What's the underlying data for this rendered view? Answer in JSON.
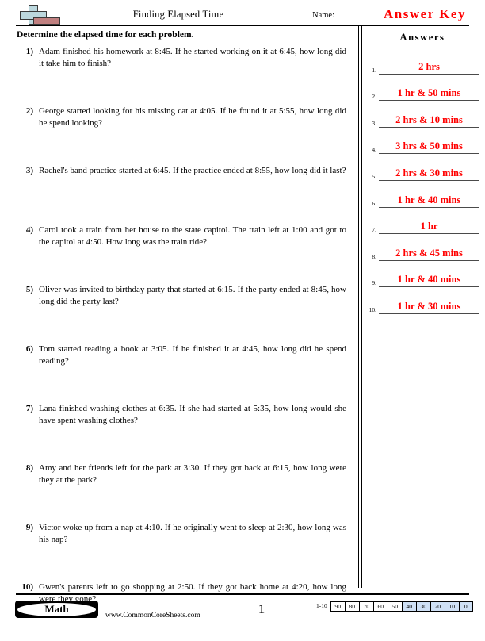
{
  "header": {
    "logo_name": "commoncoresheets-cross-logo",
    "title": "Finding Elapsed Time",
    "name_label": "Name:",
    "answer_key_label": "Answer Key"
  },
  "instructions": "Determine the elapsed time for each problem.",
  "questions": [
    {
      "num": "1)",
      "text": "Adam finished his homework at 8:45. If he started working on it at 6:45, how long did it take him to finish?"
    },
    {
      "num": "2)",
      "text": "George started looking for his missing cat at 4:05. If he found it at 5:55, how long did he spend looking?"
    },
    {
      "num": "3)",
      "text": "Rachel's band practice started at 6:45. If the practice ended at 8:55, how long did it last?"
    },
    {
      "num": "4)",
      "text": "Carol took a train from her house to the state capitol. The train left at 1:00 and got to the capitol at 4:50. How long was the train ride?"
    },
    {
      "num": "5)",
      "text": "Oliver was invited to birthday party that started at 6:15. If the party ended at 8:45, how long did the party last?"
    },
    {
      "num": "6)",
      "text": "Tom started reading a book at 3:05. If he finished it at 4:45, how long did he spend reading?"
    },
    {
      "num": "7)",
      "text": "Lana finished washing clothes at 6:35. If she had started at 5:35, how long would she have spent washing clothes?"
    },
    {
      "num": "8)",
      "text": "Amy and her friends left for the park at 3:30. If they got back at 6:15, how long were they at the park?"
    },
    {
      "num": "9)",
      "text": "Victor woke up from a nap at 4:10. If he originally went to sleep at 2:30, how long was his nap?"
    },
    {
      "num": "10)",
      "text": "Gwen's parents left to go shopping at 2:50. If they got back home at 4:20, how long were they gone?"
    }
  ],
  "answers": {
    "heading": "Answers",
    "items": [
      {
        "idx": "1.",
        "value": "2 hrs"
      },
      {
        "idx": "2.",
        "value": "1 hr & 50 mins"
      },
      {
        "idx": "3.",
        "value": "2 hrs & 10 mins"
      },
      {
        "idx": "4.",
        "value": "3 hrs & 50 mins"
      },
      {
        "idx": "5.",
        "value": "2 hrs & 30 mins"
      },
      {
        "idx": "6.",
        "value": "1 hr & 40 mins"
      },
      {
        "idx": "7.",
        "value": "1 hr"
      },
      {
        "idx": "8.",
        "value": "2 hrs & 45 mins"
      },
      {
        "idx": "9.",
        "value": "1 hr & 40 mins"
      },
      {
        "idx": "10.",
        "value": "1 hr & 30 mins"
      }
    ]
  },
  "footer": {
    "subject_badge": "Math",
    "site_url": "www.CommonCoreSheets.com",
    "page_number": "1",
    "scale_range_label": "1-10",
    "scale_values": [
      "90",
      "80",
      "70",
      "60",
      "50",
      "40",
      "30",
      "20",
      "10",
      "0"
    ],
    "scale_highlight_from_index": 5,
    "highlight_color": "#cfe0f5",
    "answer_color": "#ff0000"
  }
}
